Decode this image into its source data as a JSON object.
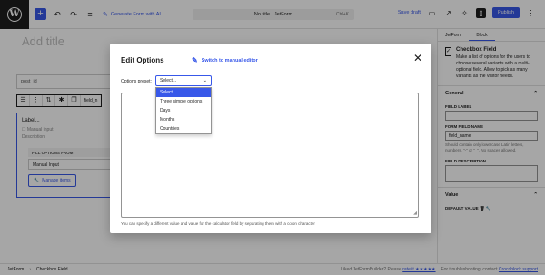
{
  "toolbar": {
    "wp_logo": "W",
    "generate_label": "Generate Form with AI",
    "doc_title": "No title · JetForm",
    "shortcut": "Ctrl+K",
    "save_draft": "Save draft",
    "publish": "Publish"
  },
  "canvas": {
    "title_placeholder": "Add title",
    "post_id_field": "post_id",
    "field_name_chip": "field_n",
    "field_label": "Label...",
    "manual_input": "Manual input",
    "description": "Description",
    "fill_options_header": "FILL OPTIONS FROM",
    "fill_value": "Manual Input",
    "manage_items": "Manage items"
  },
  "sidebar": {
    "tab_jetform": "JetForm",
    "tab_block": "Block",
    "block_name": "Checkbox Field",
    "block_desc": "Make a list of options for the users to choose several variants with a multi-optional field. Allow to pick as many variants as the visitor needs.",
    "general": "General",
    "field_label": "FIELD LABEL",
    "form_field_name": "FORM FIELD NAME",
    "field_name_value": "field_name",
    "field_name_help": "Should contain only lowercase Latin letters, numbers, \"-\" or \"_\". No spaces allowed.",
    "field_description": "FIELD DESCRIPTION",
    "value": "Value",
    "default_value": "DEFAULT VALUE"
  },
  "footer": {
    "crumb_1": "JetForm",
    "crumb_2": "Checkbox Field",
    "rate_text": "Liked JetFormBuilder? Please",
    "rate_link": "rate it ★★★★★",
    "support_text": "For troubleshooting, contact",
    "support_link": "Crocoblock support"
  },
  "modal": {
    "title": "Edit Options",
    "switch_link": "Switch to manual editor",
    "preset_label": "Options preset:",
    "preset_value": "Select...",
    "hint": "You can specify a different value and value for the calculator field by separating them with a colon character",
    "dropdown_options": [
      "Select...",
      "Three simple options",
      "Days",
      "Months",
      "Countries"
    ],
    "selected_option": "Select..."
  }
}
